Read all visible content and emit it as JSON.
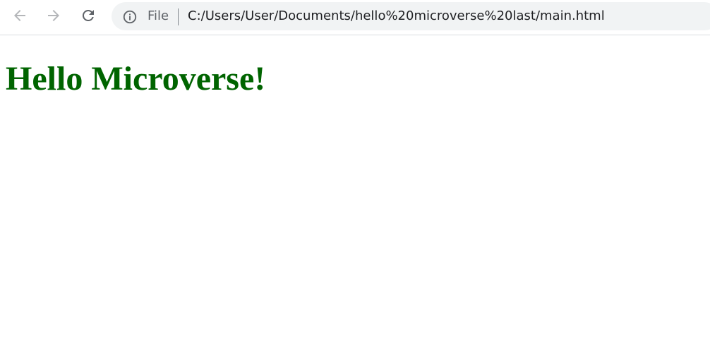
{
  "toolbar": {
    "icons": {
      "back": "arrow-left-icon",
      "forward": "arrow-right-icon",
      "reload": "reload-icon",
      "site_info": "info-circle-icon"
    },
    "omnibox": {
      "scheme_label": "File",
      "url": "C:/Users/User/Documents/hello%20microverse%20last/main.html"
    }
  },
  "page": {
    "heading": "Hello Microverse!",
    "heading_color": "#006400"
  },
  "colors": {
    "nav_icon_disabled": "#b4b6b9",
    "nav_icon_active": "#5f6368",
    "omnibox_bg": "#f1f3f4"
  }
}
